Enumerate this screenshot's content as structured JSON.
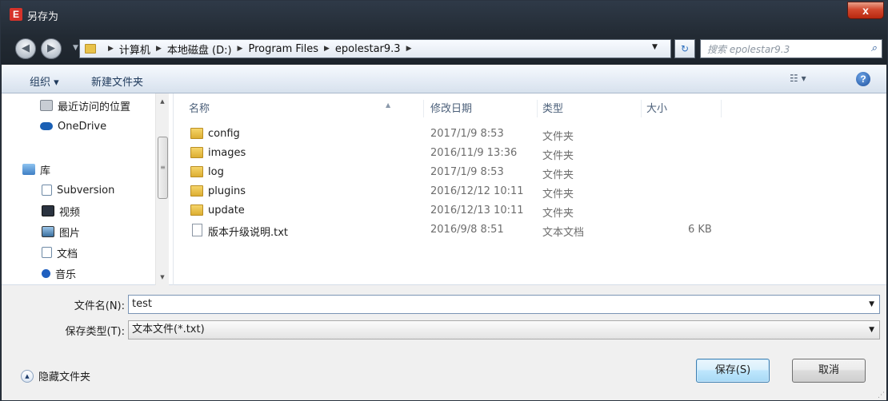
{
  "window": {
    "title": "另存为",
    "app_icon_letter": "E",
    "close_label": "x"
  },
  "address": {
    "breadcrumbs": [
      "计算机",
      "本地磁盘 (D:)",
      "Program Files",
      "epolestar9.3"
    ],
    "search_placeholder": "搜索 epolestar9.3"
  },
  "toolbar": {
    "organize_label": "组织 ▾",
    "new_folder_label": "新建文件夹",
    "help_label": "?"
  },
  "nav": {
    "items": [
      {
        "label": "最近访问的位置",
        "icon": "recent-places-icon"
      },
      {
        "label": "OneDrive",
        "icon": "onedrive-icon"
      },
      {
        "label": "库",
        "icon": "library-icon"
      },
      {
        "label": "Subversion",
        "icon": "document-icon"
      },
      {
        "label": "视频",
        "icon": "video-icon"
      },
      {
        "label": "图片",
        "icon": "picture-icon"
      },
      {
        "label": "文档",
        "icon": "document-icon"
      },
      {
        "label": "音乐",
        "icon": "music-icon"
      }
    ]
  },
  "files": {
    "columns": [
      "名称",
      "修改日期",
      "类型",
      "大小"
    ],
    "rows": [
      {
        "name": "config",
        "date": "2017/1/9 8:53",
        "type": "文件夹",
        "size": "",
        "icon": "folder-icon"
      },
      {
        "name": "images",
        "date": "2016/11/9 13:36",
        "type": "文件夹",
        "size": "",
        "icon": "folder-icon"
      },
      {
        "name": "log",
        "date": "2017/1/9 8:53",
        "type": "文件夹",
        "size": "",
        "icon": "folder-icon"
      },
      {
        "name": "plugins",
        "date": "2016/12/12 10:11",
        "type": "文件夹",
        "size": "",
        "icon": "folder-icon"
      },
      {
        "name": "update",
        "date": "2016/12/13 10:11",
        "type": "文件夹",
        "size": "",
        "icon": "folder-icon"
      },
      {
        "name": "版本升级说明.txt",
        "date": "2016/9/8 8:51",
        "type": "文本文档",
        "size": "6 KB",
        "icon": "text-file-icon"
      }
    ]
  },
  "form": {
    "filename_label": "文件名(N):",
    "filename_value": "test",
    "filetype_label": "保存类型(T):",
    "filetype_value": "文本文件(*.txt)",
    "hide_folders_label": "隐藏文件夹",
    "save_label": "保存(S)",
    "cancel_label": "取消"
  }
}
